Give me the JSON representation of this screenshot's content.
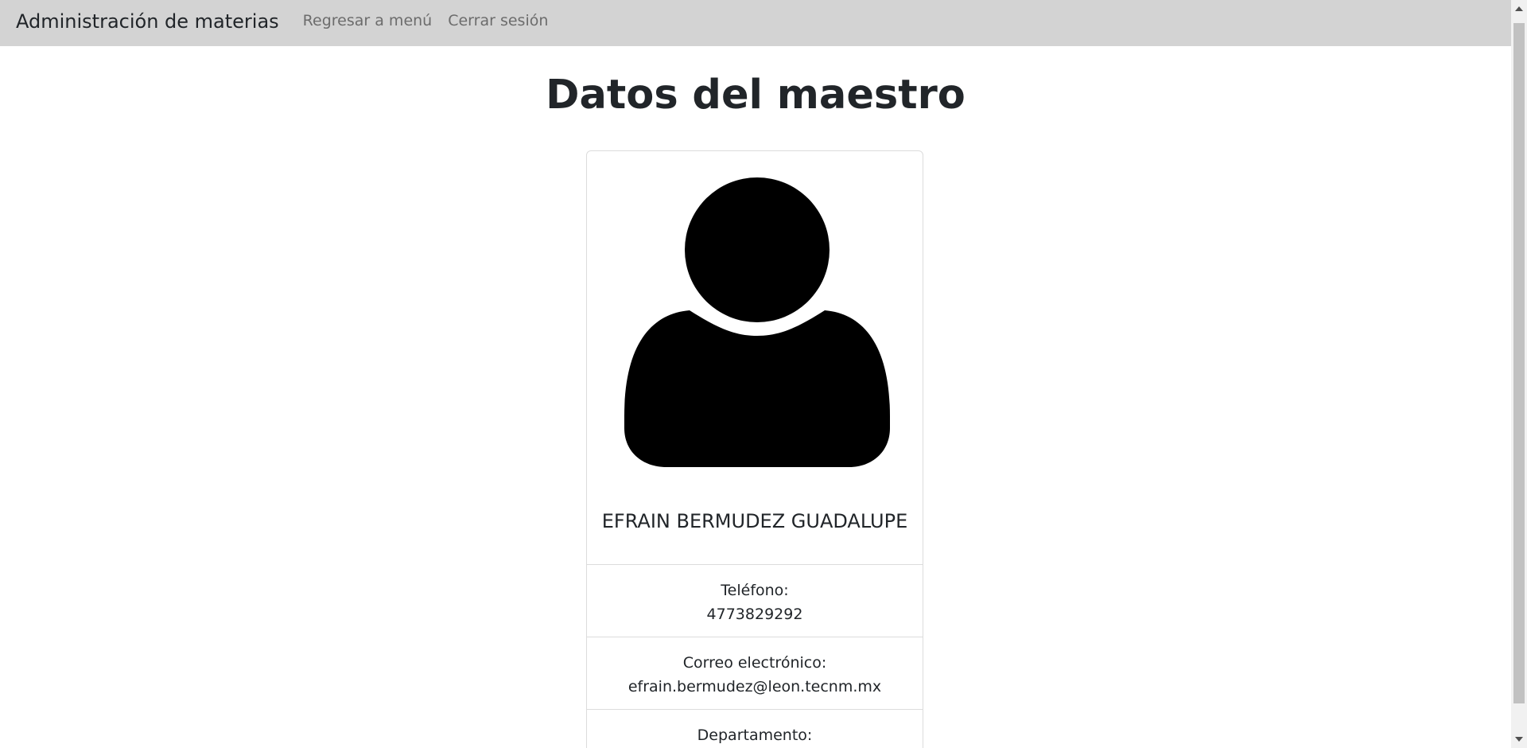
{
  "navbar": {
    "brand": "Administración de materias",
    "links": [
      {
        "label": "Regresar a menú"
      },
      {
        "label": "Cerrar sesión"
      }
    ],
    "background": "#d3d3d3"
  },
  "page": {
    "title": "Datos del maestro"
  },
  "teacher": {
    "avatar_icon": "user-silhouette-icon",
    "name": "EFRAIN BERMUDEZ GUADALUPE",
    "fields": [
      {
        "label": "Teléfono:",
        "value": "4773829292"
      },
      {
        "label": "Correo electrónico:",
        "value": "efrain.bermudez@leon.tecnm.mx"
      },
      {
        "label": "Departamento:",
        "value": ""
      }
    ]
  }
}
